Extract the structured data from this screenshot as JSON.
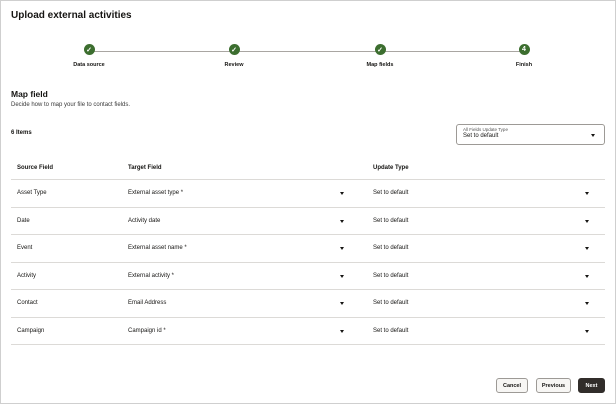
{
  "header": {
    "title": "Upload external activities"
  },
  "steps": [
    {
      "label": "Data source",
      "status": "complete",
      "marker": "✓"
    },
    {
      "label": "Review",
      "status": "complete",
      "marker": "✓"
    },
    {
      "label": "Map fields",
      "status": "complete",
      "marker": "✓"
    },
    {
      "label": "Finish",
      "status": "current",
      "marker": "4"
    }
  ],
  "section": {
    "title": "Map field",
    "description": "Decide how to map your file to contact fields."
  },
  "items_count": "6 Items",
  "bulk_update": {
    "label": "All Fields Update Type",
    "value": "Set to default"
  },
  "table": {
    "headers": {
      "source": "Source Field",
      "target": "Target Field",
      "update": "Update Type"
    },
    "rows": [
      {
        "source": "Asset Type",
        "target": "External asset type *",
        "update": "Set to default"
      },
      {
        "source": "Date",
        "target": "Activity date",
        "update": "Set to default"
      },
      {
        "source": "Event",
        "target": "External asset name *",
        "update": "Set to default"
      },
      {
        "source": "Activity",
        "target": "External activity *",
        "update": "Set to default"
      },
      {
        "source": "Contact",
        "target": "Email Address",
        "update": "Set to default"
      },
      {
        "source": "Campaign",
        "target": "Campaign id *",
        "update": "Set to default"
      }
    ]
  },
  "footer": {
    "cancel": "Cancel",
    "previous": "Previous",
    "next": "Next"
  },
  "colors": {
    "step_complete": "#3c6e2f",
    "primary_button": "#312d2a"
  }
}
